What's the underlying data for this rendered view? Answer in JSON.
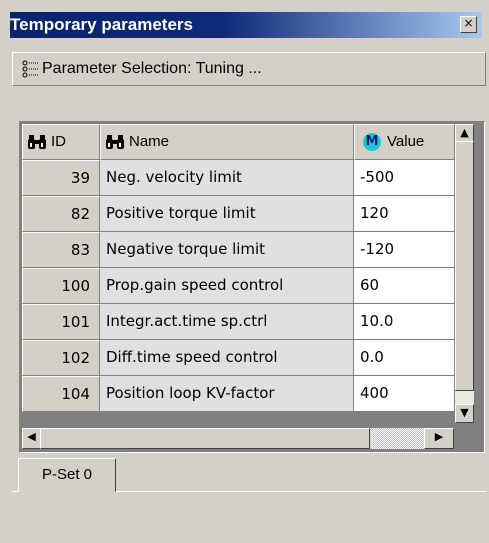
{
  "window": {
    "title": "Temporary parameters",
    "close_label": "×"
  },
  "selection": {
    "label": "Parameter Selection: Tuning ..."
  },
  "table": {
    "headers": {
      "id": "ID",
      "name": "Name",
      "value": "Value",
      "value_badge": "M"
    },
    "rows": [
      {
        "id": "39",
        "name": "Neg. velocity limit",
        "value": "-500"
      },
      {
        "id": "82",
        "name": "Positive torque limit",
        "value": "120"
      },
      {
        "id": "83",
        "name": "Negative torque limit",
        "value": "-120"
      },
      {
        "id": "100",
        "name": "Prop.gain speed control",
        "value": "60"
      },
      {
        "id": "101",
        "name": "Integr.act.time sp.ctrl",
        "value": "10.0"
      },
      {
        "id": "102",
        "name": "Diff.time speed control",
        "value": "0.0"
      },
      {
        "id": "104",
        "name": "Position loop KV-factor",
        "value": "400"
      }
    ]
  },
  "scrollbars": {
    "up": "▲",
    "down": "▼",
    "left": "◀",
    "right": "▶"
  },
  "tabs": [
    {
      "label": "P-Set 0",
      "active": true
    }
  ],
  "colors": {
    "titlebar_start": "#0a246a",
    "titlebar_end": "#a6caf0",
    "face": "#d4d0c8",
    "value_badge": "#18c8d8"
  },
  "icons": {
    "selection": "list-icon",
    "id_header": "binoculars-icon",
    "name_header": "binoculars-icon",
    "value_header": "m-badge-icon"
  }
}
